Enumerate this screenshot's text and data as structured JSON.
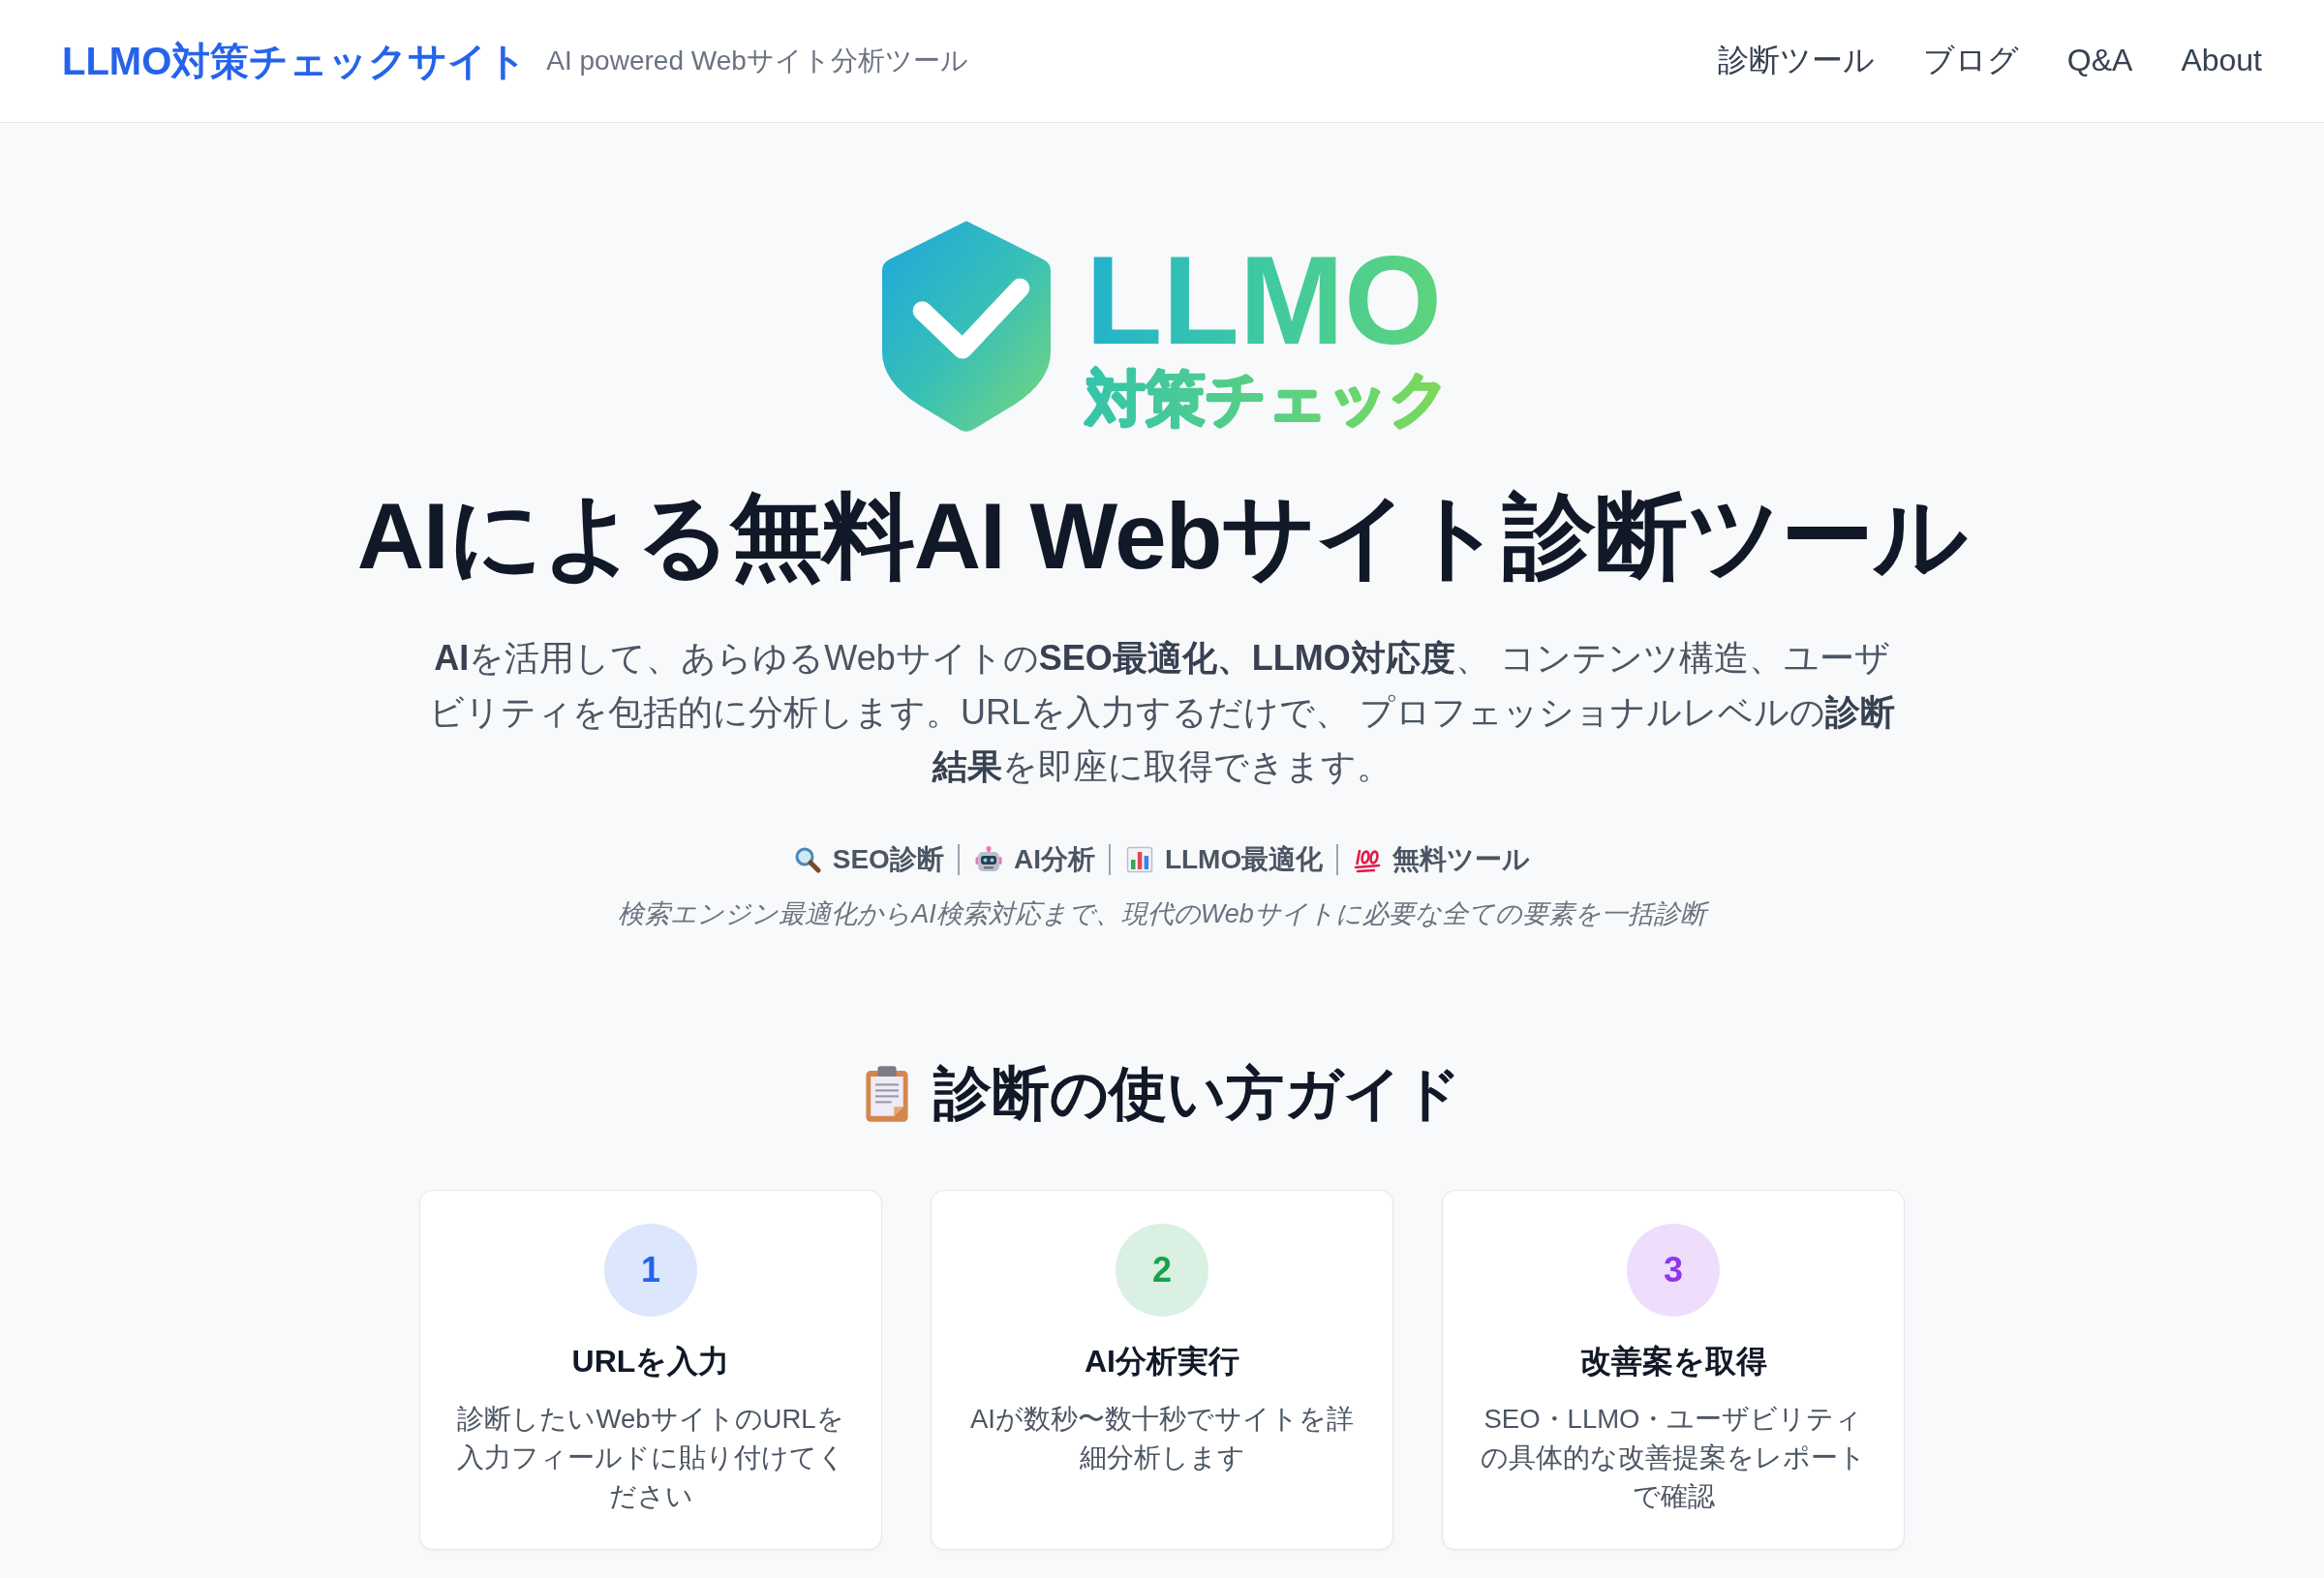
{
  "header": {
    "brand": "LLMO対策チェックサイト",
    "subtitle": "AI powered Webサイト分析ツール",
    "nav": [
      {
        "label": "診断ツール"
      },
      {
        "label": "ブログ"
      },
      {
        "label": "Q&A"
      },
      {
        "label": "About"
      }
    ]
  },
  "hero": {
    "logo": {
      "wordmark": "LLMO",
      "tagline": "対策チェック"
    },
    "title": "AIによる無料AI Webサイト診断ツール",
    "description": "**AI**を活用して、あらゆるWebサイトの**SEO最適化、LLMO対応度**、 コンテンツ構造、ユーザビリティを包括的に分析します。URLを入力するだけで、 プロフェッショナルレベルの**診断結果**を即座に取得できます。",
    "features": [
      {
        "kind": "search",
        "label": "SEO診断"
      },
      {
        "kind": "robot",
        "label": "AI分析"
      },
      {
        "kind": "chart",
        "label": "LLMO最適化"
      },
      {
        "kind": "hundred",
        "label": "無料ツール"
      }
    ],
    "note": "検索エンジン最適化からAI検索対応まで、現代のWebサイトに必要な全ての要素を一括診断"
  },
  "guide": {
    "title": "診断の使い方ガイド",
    "steps": [
      {
        "number": "1",
        "color": "#2563eb",
        "title": "URLを入力",
        "description": "診断したいWebサイトのURLを入力フィールドに貼り付けてください"
      },
      {
        "number": "2",
        "color": "#16a34a",
        "title": "AI分析実行",
        "description": "AIが数秒〜数十秒でサイトを詳細分析します"
      },
      {
        "number": "3",
        "color": "#9333ea",
        "title": "改善案を取得",
        "description": "SEO・LLMO・ユーザビリティの具体的な改善提案をレポートで確認"
      }
    ]
  }
}
